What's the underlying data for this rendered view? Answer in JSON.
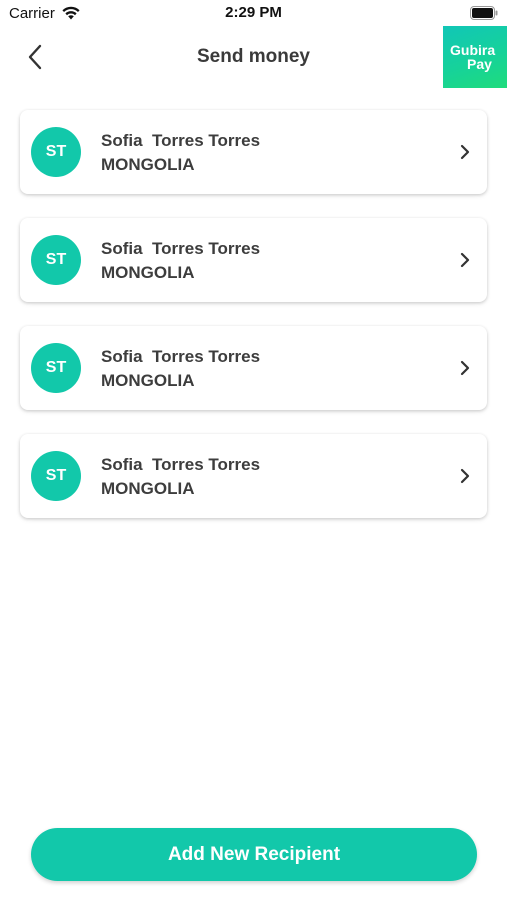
{
  "status_bar": {
    "carrier": "Carrier",
    "time": "2:29 PM"
  },
  "header": {
    "title": "Send money",
    "brand": {
      "line1": "Gubira",
      "line2": "Pay"
    }
  },
  "recipients": [
    {
      "initials": "ST",
      "name": "Sofia  Torres Torres",
      "country": "MONGOLIA"
    },
    {
      "initials": "ST",
      "name": "Sofia  Torres Torres",
      "country": "MONGOLIA"
    },
    {
      "initials": "ST",
      "name": "Sofia  Torres Torres",
      "country": "MONGOLIA"
    },
    {
      "initials": "ST",
      "name": "Sofia  Torres Torres",
      "country": "MONGOLIA"
    }
  ],
  "actions": {
    "add_recipient_label": "Add New Recipient"
  },
  "icons": {
    "back": "chevron-left-icon",
    "row": "chevron-right-icon",
    "wifi": "wifi-icon",
    "battery": "battery-icon"
  },
  "colors": {
    "accent": "#12c8aa",
    "text": "#3d3d3d",
    "logo_gradient_start": "#11c6b7",
    "logo_gradient_end": "#1fdc7c"
  }
}
